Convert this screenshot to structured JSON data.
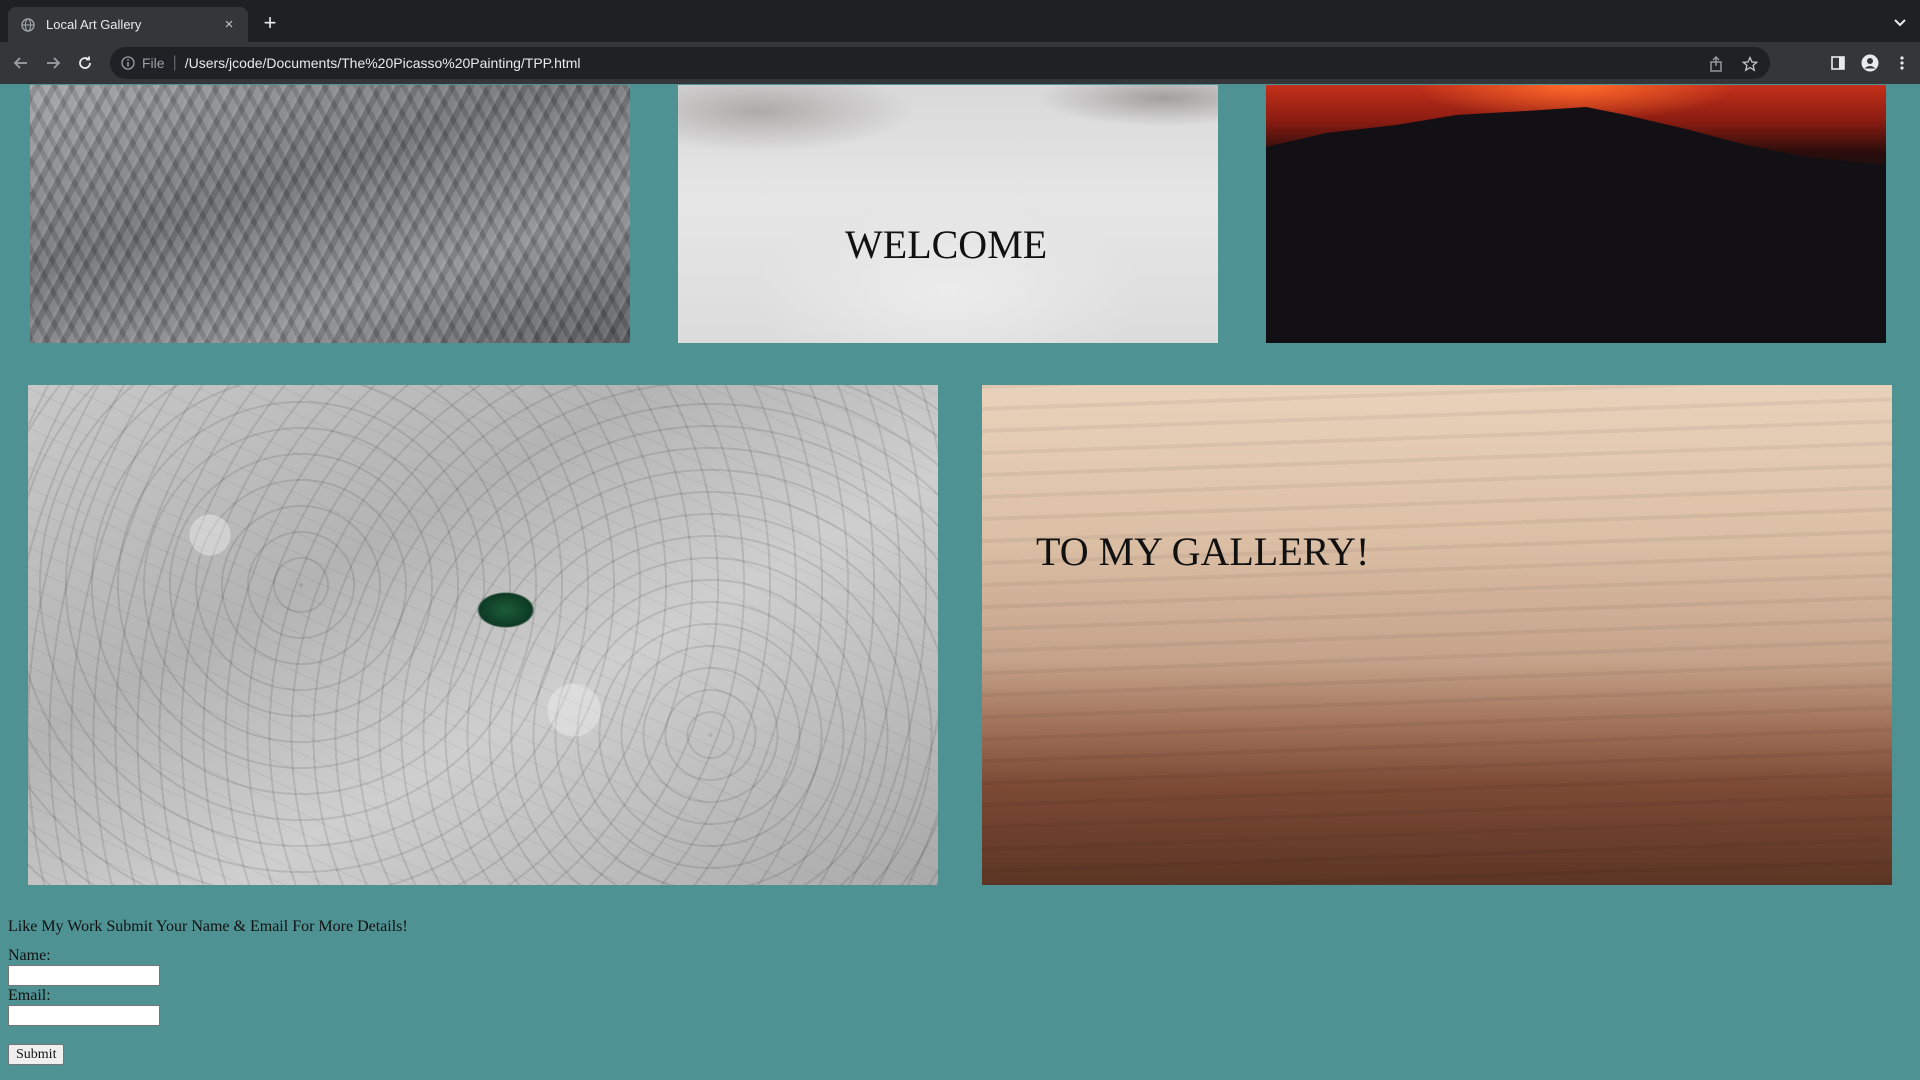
{
  "browser": {
    "tab_title": "Local Art Gallery",
    "tab_close": "×",
    "new_tab": "+",
    "scheme_label": "File",
    "url": "/Users/jcode/Documents/The%20Picasso%20Painting/TPP.html"
  },
  "page": {
    "welcome_text": "WELCOME",
    "gallery_text": "TO MY GALLERY!",
    "background_color": "#4f9294"
  },
  "form": {
    "intro": "Like My Work Submit Your Name & Email For More Details!",
    "name_label": "Name:",
    "name_value": "",
    "email_label": "Email:",
    "email_value": "",
    "submit_label": "Submit"
  }
}
